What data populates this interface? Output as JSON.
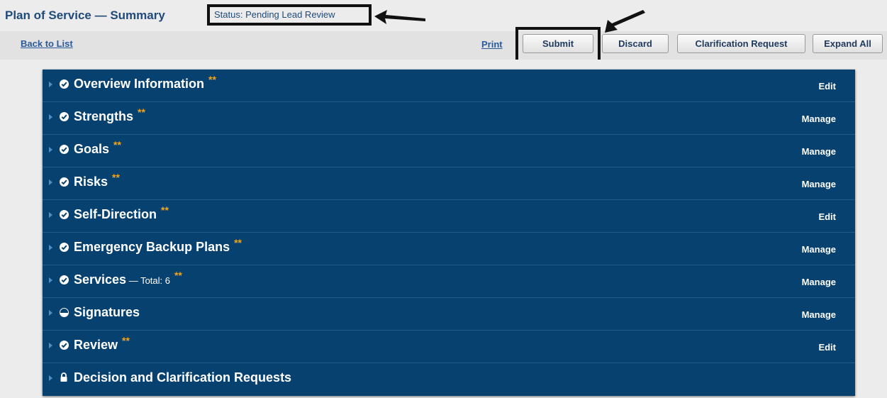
{
  "header": {
    "title": "Plan of Service — Summary",
    "status": "Status: Pending Lead Review"
  },
  "toolbar": {
    "back_link": "Back to List",
    "print_link": "Print",
    "submit_label": "Submit",
    "discard_label": "Discard",
    "clarification_label": "Clarification Request",
    "expand_label": "Expand All"
  },
  "sections": [
    {
      "label": "Overview Information",
      "extra": "",
      "stars": "**",
      "action": "Edit"
    },
    {
      "label": "Strengths",
      "extra": "",
      "stars": "**",
      "action": "Manage"
    },
    {
      "label": "Goals",
      "extra": "",
      "stars": "**",
      "action": "Manage"
    },
    {
      "label": "Risks",
      "extra": "",
      "stars": "**",
      "action": "Manage"
    },
    {
      "label": "Self-Direction",
      "extra": "",
      "stars": "**",
      "action": "Edit"
    },
    {
      "label": "Emergency Backup Plans",
      "extra": "",
      "stars": "**",
      "action": "Manage"
    },
    {
      "label": "Services",
      "extra": " — Total: 6",
      "stars": "**",
      "action": "Manage"
    },
    {
      "label": "Signatures",
      "extra": "",
      "stars": "",
      "action": "Manage"
    },
    {
      "label": "Review",
      "extra": "",
      "stars": "**",
      "action": "Edit"
    },
    {
      "label": "Decision and Clarification Requests",
      "extra": "",
      "stars": "",
      "action": ""
    }
  ],
  "icons": {
    "row_toggle": "caret-right-icon",
    "complete": "check-circle-icon",
    "partial": "half-circle-icon",
    "locked": "lock-icon"
  },
  "colors": {
    "panel": "#06416f",
    "title": "#1f4a7a",
    "stars": "#f3a51d",
    "link": "#2b5a9a"
  }
}
